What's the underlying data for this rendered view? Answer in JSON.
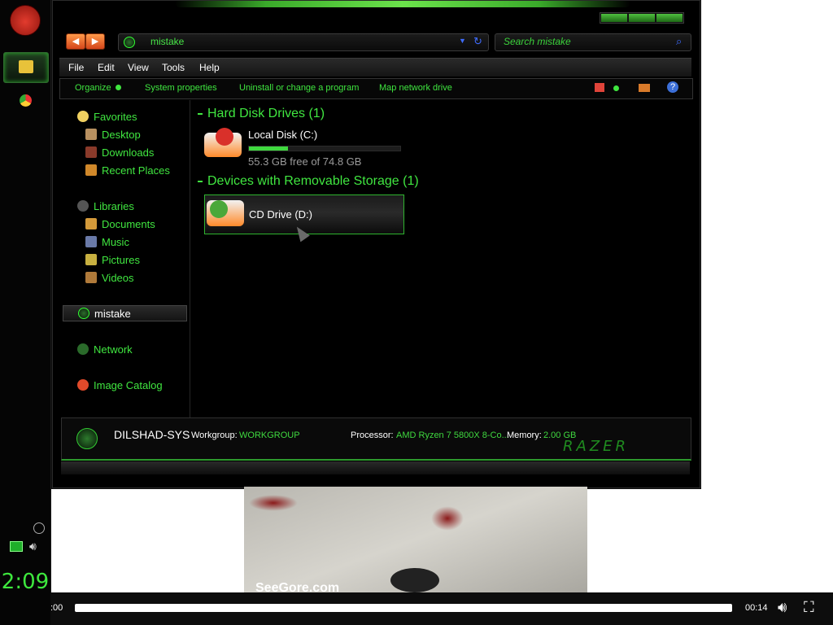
{
  "taskbar": {
    "clock": "2:09"
  },
  "window": {
    "address": "mistake",
    "search_placeholder": "Search mistake",
    "menu": [
      "File",
      "Edit",
      "View",
      "Tools",
      "Help"
    ],
    "commands": [
      "Organize",
      "System properties",
      "Uninstall or change a program",
      "Map network drive"
    ]
  },
  "nav": {
    "favorites": "Favorites",
    "desktop": "Desktop",
    "downloads": "Downloads",
    "recent": "Recent Places",
    "libraries": "Libraries",
    "documents": "Documents",
    "music": "Music",
    "pictures": "Pictures",
    "videos": "Videos",
    "computer": "mistake",
    "network": "Network",
    "image_catalog": "Image Catalog"
  },
  "content": {
    "hdd_group": "Hard Disk Drives (1)",
    "local_disk": {
      "name": "Local Disk (C:)",
      "space": "55.3 GB free of 74.8 GB",
      "used_fraction": 0.26
    },
    "removable_group": "Devices with Removable Storage (1)",
    "cd_drive": {
      "name": "CD Drive (D:)"
    }
  },
  "details": {
    "computer_name": "DILSHAD-SYS",
    "workgroup_label": "Workgroup:",
    "workgroup": "WORKGROUP",
    "processor_label": "Processor:",
    "processor": "AMD Ryzen 7 5800X 8-Co...",
    "memory_label": "Memory:",
    "memory": "2.00 GB",
    "brand": "RAZER"
  },
  "player": {
    "elapsed": ":00",
    "duration": "00:14",
    "watermark": "SeeGore.com"
  },
  "colors": {
    "accent": "#40e640",
    "background": "#000000"
  }
}
